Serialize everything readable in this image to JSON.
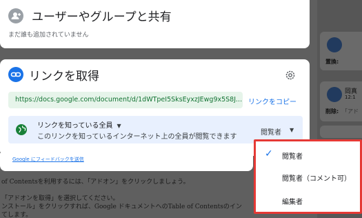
{
  "share": {
    "title": "ユーザーやグループと共有",
    "subtitle": "まだ誰も追加されていません"
  },
  "link": {
    "title": "リンクを取得",
    "url": "https://docs.google.com/document/d/1dWTpeI5SksEyxzJEwg9x5S8J...",
    "copy_label": "リンクをコピー",
    "access_who": "リンクを知っている全員",
    "access_desc": "このリンクを知っているインターネット上の全員が閲覧できます",
    "role": "閲覧者"
  },
  "feedback": "Google にフィードバックを送信",
  "dropdown": {
    "items": [
      "閲覧者",
      "閲覧者（コメント可）",
      "編集者"
    ],
    "selected_index": 0
  },
  "background": {
    "line1": "of Contentsを利用するには、「アドオン」をクリックしましょう。",
    "line2": "「アドオンを取得」を選択してください。",
    "line3": "ンストール」をクリックすれば、Google ドキュメントへのTable of Contentsのイン",
    "line4": "てします。"
  },
  "right_pane": {
    "card1_label": "置換:",
    "card2_name": "岡真",
    "card2_time": "12:1",
    "card2_label": "削除:",
    "card2_text": "「アド"
  },
  "colors": {
    "accent": "#1a73e8",
    "link_green": "#137333",
    "highlight": "#e53935"
  }
}
